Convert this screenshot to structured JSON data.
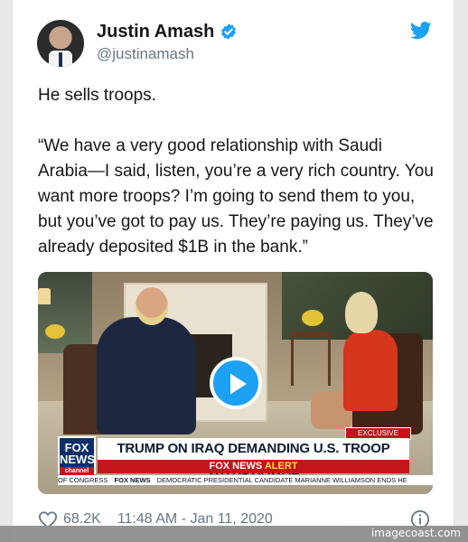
{
  "author": {
    "name": "Justin Amash",
    "handle": "@justinamash",
    "verified_icon": "verified-badge-icon",
    "avatar_icon": "profile-avatar"
  },
  "brand": {
    "icon": "twitter-bird-icon",
    "accent_color": "#1da1f2"
  },
  "tweet": {
    "line1": "He sells troops.",
    "line2": "“We have a very good relationship with Saudi Arabia—I said, listen, you’re a very rich country. You want more troops? I’m going to send them to you, but you’ve got to pay us. They’re paying us. They’ve already deposited $1B in the bank.”"
  },
  "video": {
    "play_icon": "play-icon",
    "exclusive_label": "EXCLUSIVE",
    "fox_logo_line1": "FOX",
    "fox_logo_line2": "NEWS",
    "fox_logo_line3": "channel",
    "headline": "TRUMP ON IRAQ DEMANDING U.S. TROOP WITHDRAWAL",
    "alert_prefix": "FOX NEWS",
    "alert_word": "ALERT",
    "ticker_left": "OF CONGRESS",
    "ticker_brand": "FOX NEWS",
    "ticker_right": "DEMOCRATIC PRESIDENTIAL CANDIDATE MARIANNE WILLIAMSON ENDS HE"
  },
  "footer": {
    "likes": "68.2K",
    "timestamp": "11:48 AM - Jan 11, 2020",
    "like_icon": "heart-icon",
    "info_icon": "info-icon"
  },
  "watermark": {
    "text": "imagecoast.com"
  }
}
